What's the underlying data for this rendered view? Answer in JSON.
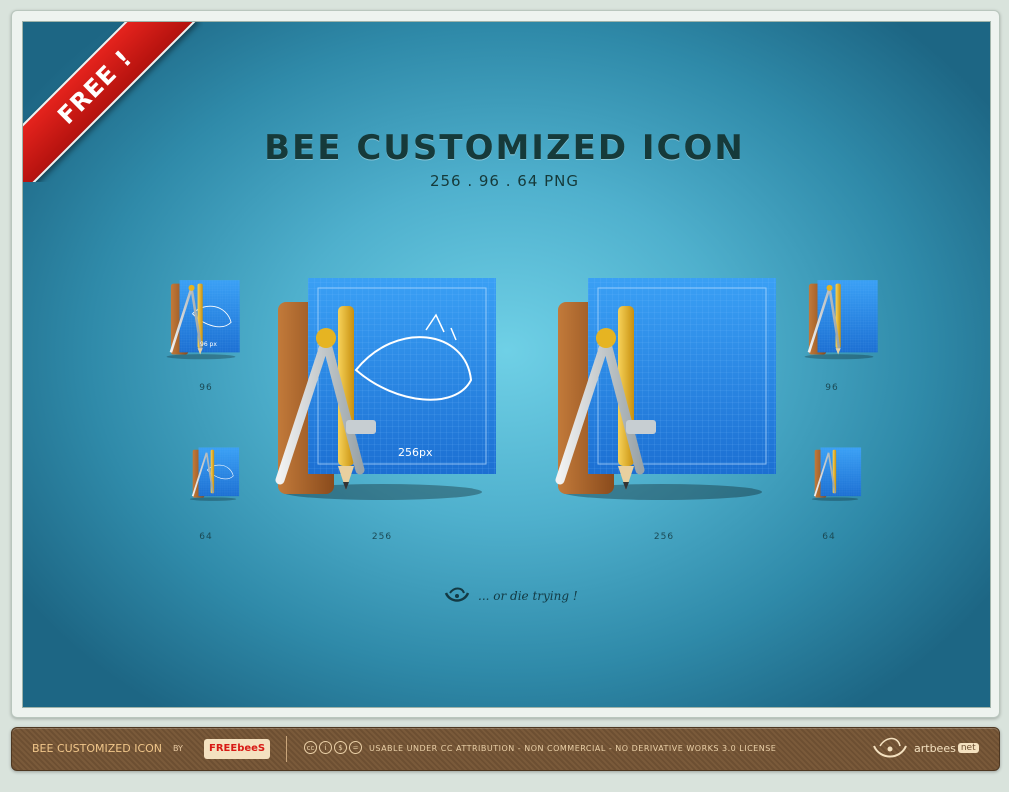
{
  "ribbon": {
    "label": "FREE !"
  },
  "heading": {
    "title": "BEE CUSTOMIZED ICON",
    "subtitle": "256 . 96 . 64 PNG"
  },
  "icons": {
    "left_96_label": "96",
    "left_64_label": "64",
    "left_256_label": "256",
    "right_256_label": "256",
    "right_96_label": "96",
    "right_64_label": "64",
    "sketch_text_small": "96 px",
    "sketch_text_large": "256px"
  },
  "tagline": {
    "text": "... or die trying !"
  },
  "footer": {
    "title": "BEE CUSTOMIZED ICON",
    "by": "BY",
    "brand": "FREEbeeS",
    "cc_symbols": [
      "cc",
      "i",
      "$",
      "="
    ],
    "license": "USABLE UNDER CC ATTRIBUTION - NON COMMERCIAL - NO DERIVATIVE WORKS 3.0 LICENSE",
    "logo_text": "artbees",
    "logo_suffix": "net"
  },
  "colors": {
    "ribbon": "#d81a15",
    "title": "#163a3a",
    "blueprint": "#2a86e0",
    "wood": "#a65f2a",
    "pencil": "#e6b422"
  }
}
